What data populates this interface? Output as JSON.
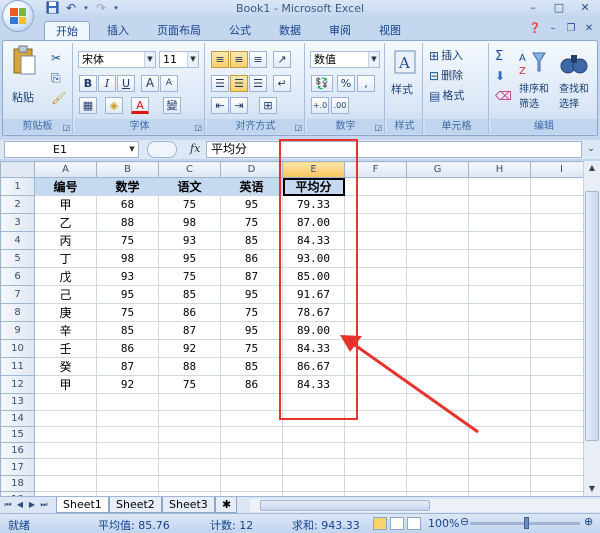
{
  "app": {
    "title": "Book1 - Microsoft Excel",
    "window_controls": [
      "–",
      "□",
      "✕"
    ]
  },
  "quick_access": {
    "save_icon": "save-icon",
    "undo_icon": "undo-icon",
    "redo_icon": "redo-icon"
  },
  "tabs": [
    {
      "label": "开始",
      "active": true
    },
    {
      "label": "插入",
      "active": false
    },
    {
      "label": "页面布局",
      "active": false
    },
    {
      "label": "公式",
      "active": false
    },
    {
      "label": "数据",
      "active": false
    },
    {
      "label": "审阅",
      "active": false
    },
    {
      "label": "视图",
      "active": false
    }
  ],
  "ribbon": {
    "clipboard": {
      "label": "剪贴板",
      "paste": "粘贴"
    },
    "font": {
      "label": "字体",
      "name": "宋体",
      "size": "11",
      "bold": "B",
      "italic": "I",
      "underline": "U",
      "grow": "A",
      "shrink": "A",
      "font_color": "A",
      "wen": "變"
    },
    "alignment": {
      "label": "对齐方式"
    },
    "number": {
      "label": "数字",
      "format": "数值",
      "percent": "%",
      "comma": ","
    },
    "styles": {
      "label": "样式",
      "button": "样式"
    },
    "cells": {
      "label": "单元格",
      "insert": "插入",
      "delete": "删除",
      "format": "格式"
    },
    "editing": {
      "label": "编辑",
      "sort": "排序和",
      "sort2": "筛选",
      "find": "查找和",
      "find2": "选择"
    }
  },
  "formula_bar": {
    "name_box": "E1",
    "fx": "fx",
    "content": "平均分"
  },
  "grid": {
    "columns": [
      "A",
      "B",
      "C",
      "D",
      "E",
      "F",
      "G",
      "H",
      "I"
    ],
    "selected_column": "E",
    "row_count": 20,
    "header": [
      "编号",
      "数学",
      "语文",
      "英语",
      "平均分"
    ],
    "rows": [
      [
        "甲",
        "68",
        "75",
        "95",
        "79.33"
      ],
      [
        "乙",
        "88",
        "98",
        "75",
        "87.00"
      ],
      [
        "丙",
        "75",
        "93",
        "85",
        "84.33"
      ],
      [
        "丁",
        "98",
        "95",
        "86",
        "93.00"
      ],
      [
        "戊",
        "93",
        "75",
        "87",
        "85.00"
      ],
      [
        "己",
        "95",
        "85",
        "95",
        "91.67"
      ],
      [
        "庚",
        "75",
        "86",
        "75",
        "78.67"
      ],
      [
        "辛",
        "85",
        "87",
        "95",
        "89.00"
      ],
      [
        "壬",
        "86",
        "92",
        "75",
        "84.33"
      ],
      [
        "癸",
        "87",
        "88",
        "85",
        "86.67"
      ],
      [
        "甲",
        "92",
        "75",
        "86",
        "84.33"
      ]
    ]
  },
  "sheets": [
    "Sheet1",
    "Sheet2",
    "Sheet3"
  ],
  "active_sheet": "Sheet1",
  "status_bar": {
    "mode": "就绪",
    "average": "平均值: 85.76",
    "count": "计数: 12",
    "sum": "求和: 943.33",
    "zoom": "100%"
  },
  "colors": {
    "ribbon_bg": "#dbe7f6",
    "header_fill": "#c5d9f1",
    "annotation_red": "#e8332d",
    "selected_col_header": "#f7c45c"
  }
}
